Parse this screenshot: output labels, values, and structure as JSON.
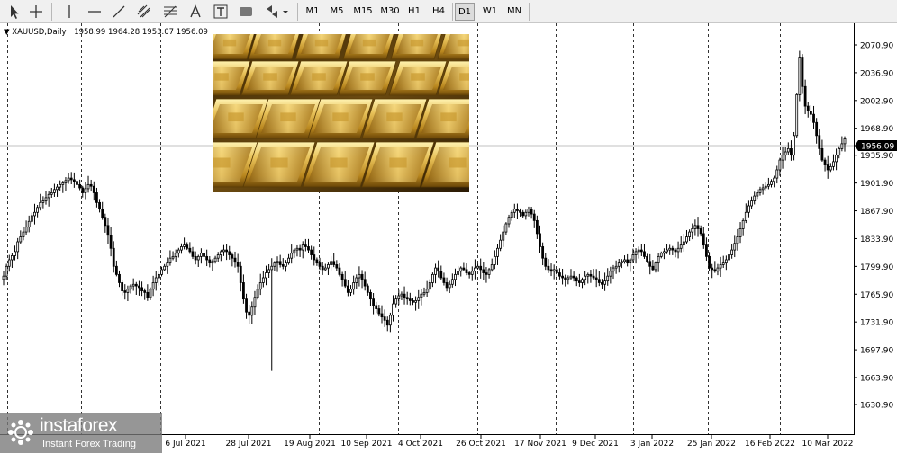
{
  "toolbar": {
    "timeframes": [
      "M1",
      "M5",
      "M15",
      "M30",
      "H1",
      "H4",
      "D1",
      "W1",
      "MN"
    ],
    "active_timeframe": "D1"
  },
  "chart_header": {
    "symbol": "XAUUSD,Daily",
    "ohlc": "1958.99 1964.28 1953.07 1956.09"
  },
  "watermark": {
    "brand": "instaforex",
    "tagline": "Instant Forex Trading"
  },
  "colors": {
    "background": "#ffffff",
    "candle": "#000000",
    "grid_vertical": "#000000",
    "price_line": "#c0c0c0",
    "current_price_label_bg": "#000000",
    "current_price_label_text": "#ffffff"
  },
  "chart_data": {
    "type": "candlestick",
    "symbol": "XAUUSD",
    "timeframe": "Daily",
    "last_ohlc": {
      "open": 1958.99,
      "high": 1964.28,
      "low": 1953.07,
      "close": 1956.09
    },
    "current_price": 1956.09,
    "y_axis": {
      "ticks": [
        2070.9,
        2036.9,
        2002.9,
        1968.9,
        1935.9,
        1901.9,
        1867.9,
        1833.9,
        1799.9,
        1765.9,
        1731.9,
        1697.9,
        1663.9,
        1630.9
      ],
      "ylim": [
        1630.9,
        2070.9
      ]
    },
    "x_axis": {
      "tick_labels": [
        "6 Jul 2021",
        "28 Jul 2021",
        "19 Aug 2021",
        "10 Sep 2021",
        "4 Oct 2021",
        "26 Oct 2021",
        "17 Nov 2021",
        "9 Dec 2021",
        "3 Jan 2022",
        "25 Jan 2022",
        "16 Feb 2022",
        "10 Mar 2022"
      ]
    },
    "grid": "vertical dashed lines at date ticks",
    "series": [
      {
        "values": [
          1788,
          1800,
          1808,
          1813,
          1818,
          1830,
          1836,
          1842,
          1848,
          1855,
          1862,
          1866,
          1872,
          1878,
          1880,
          1884,
          1888,
          1890,
          1894,
          1897,
          1900,
          1902,
          1905,
          1908,
          1906,
          1904,
          1900,
          1896,
          1890,
          1895,
          1900,
          1898,
          1890,
          1878,
          1870,
          1860,
          1850,
          1838,
          1822,
          1800,
          1790,
          1780,
          1770,
          1768,
          1772,
          1776,
          1778,
          1776,
          1774,
          1770,
          1768,
          1762,
          1772,
          1780,
          1786,
          1790,
          1796,
          1800,
          1804,
          1810,
          1812,
          1816,
          1820,
          1824,
          1826,
          1822,
          1818,
          1812,
          1808,
          1812,
          1816,
          1812,
          1808,
          1804,
          1806,
          1810,
          1814,
          1818,
          1820,
          1818,
          1814,
          1810,
          1805,
          1800,
          1780,
          1760,
          1744,
          1740,
          1750,
          1762,
          1772,
          1780,
          1786,
          1792,
          1796,
          1800,
          1804,
          1806,
          1802,
          1800,
          1804,
          1810,
          1816,
          1820,
          1822,
          1820,
          1826,
          1824,
          1820,
          1814,
          1808,
          1804,
          1800,
          1796,
          1798,
          1802,
          1806,
          1802,
          1798,
          1790,
          1784,
          1776,
          1768,
          1772,
          1780,
          1786,
          1790,
          1784,
          1776,
          1768,
          1760,
          1752,
          1748,
          1742,
          1738,
          1734,
          1728,
          1740,
          1754,
          1760,
          1764,
          1766,
          1762,
          1760,
          1758,
          1756,
          1758,
          1762,
          1766,
          1768,
          1772,
          1780,
          1790,
          1798,
          1794,
          1786,
          1780,
          1774,
          1778,
          1784,
          1790,
          1794,
          1798,
          1796,
          1792,
          1790,
          1794,
          1798,
          1800,
          1796,
          1792,
          1790,
          1796,
          1802,
          1812,
          1822,
          1832,
          1842,
          1852,
          1860,
          1866,
          1870,
          1868,
          1866,
          1862,
          1866,
          1870,
          1864,
          1856,
          1840,
          1824,
          1810,
          1800,
          1796,
          1794,
          1796,
          1792,
          1788,
          1786,
          1784,
          1786,
          1788,
          1786,
          1782,
          1780,
          1784,
          1788,
          1790,
          1788,
          1786,
          1784,
          1780,
          1778,
          1782,
          1788,
          1794,
          1798,
          1800,
          1804,
          1806,
          1808,
          1804,
          1808,
          1814,
          1818,
          1820,
          1818,
          1812,
          1806,
          1800,
          1796,
          1804,
          1812,
          1816,
          1818,
          1820,
          1822,
          1820,
          1818,
          1822,
          1826,
          1830,
          1836,
          1842,
          1846,
          1850,
          1846,
          1840,
          1826,
          1812,
          1798,
          1796,
          1794,
          1798,
          1802,
          1804,
          1808,
          1814,
          1820,
          1828,
          1836,
          1846,
          1856,
          1866,
          1874,
          1880,
          1886,
          1890,
          1894,
          1896,
          1898,
          1900,
          1904,
          1908,
          1918,
          1930,
          1936,
          1940,
          1944,
          1936,
          1960,
          2010,
          2056,
          2020,
          1996,
          1990,
          1986,
          1976,
          1960,
          1944,
          1930,
          1924,
          1918,
          1922,
          1928,
          1936,
          1944,
          1950,
          1956
        ]
      }
    ]
  }
}
